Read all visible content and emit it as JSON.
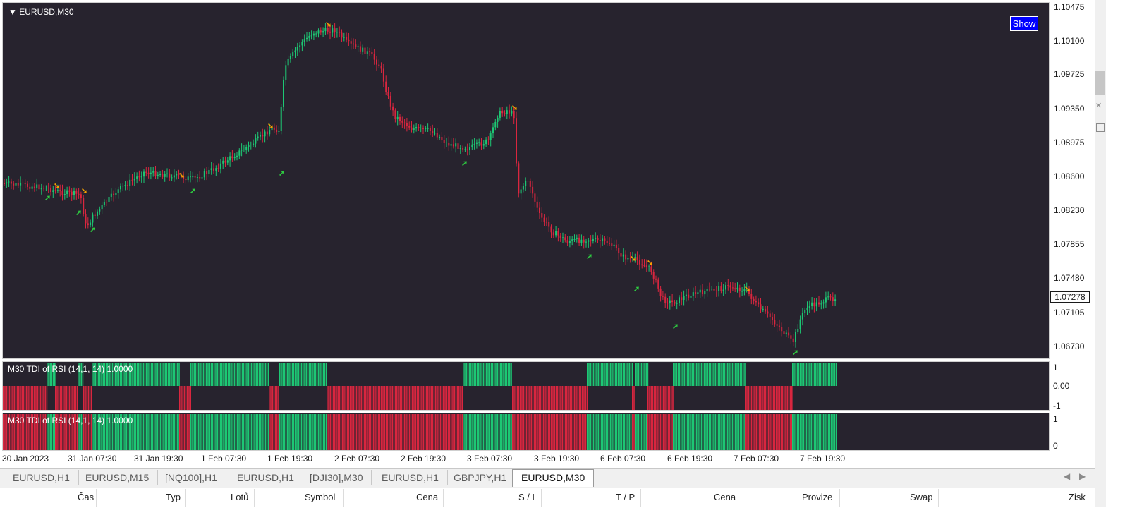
{
  "chart": {
    "symbol_label": "EURUSD,M30",
    "show_button": "Show",
    "current_price": "1.07278",
    "price_labels": [
      "1.10475",
      "1.10100",
      "1.09725",
      "1.09350",
      "1.08975",
      "1.08600",
      "1.08230",
      "1.07855",
      "1.07480",
      "1.07105",
      "1.06730"
    ],
    "time_labels": [
      "30 Jan 2023",
      "31 Jan 07:30",
      "31 Jan 19:30",
      "1 Feb 07:30",
      "1 Feb 19:30",
      "2 Feb 07:30",
      "2 Feb 19:30",
      "3 Feb 07:30",
      "3 Feb 19:30",
      "6 Feb 07:30",
      "6 Feb 19:30",
      "7 Feb 07:30",
      "7 Feb 19:30"
    ],
    "bull_color": "#1dc774",
    "bear_color": "#d9263f",
    "up_arrow_color": "#2ecc40",
    "down_arrow_color": "#f5a100"
  },
  "indicator1": {
    "label": "M30 TDI of RSI  (14,1, 14) 1.0000",
    "scale": [
      "1",
      "0.00",
      "-1"
    ]
  },
  "indicator2": {
    "label": "M30 TDI of RSI  (14,1, 14) 1.0000",
    "scale": [
      "1",
      "0"
    ]
  },
  "tabs": [
    "EURUSD,H1",
    "EURUSD,M15",
    "[NQ100],H1",
    "EURUSD,H1",
    "[DJI30],M30",
    "EURUSD,H1",
    "GBPJPY,H1",
    "EURUSD,M30"
  ],
  "active_tab": "EURUSD,M30",
  "columns": [
    "Čas",
    "Typ",
    "Lotů",
    "Symbol",
    "Cena",
    "S / L",
    "T / P",
    "Cena",
    "Provize",
    "Swap",
    "Zisk"
  ]
}
